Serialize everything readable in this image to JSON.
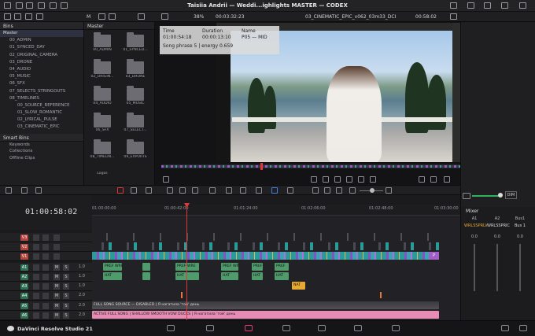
{
  "window": {
    "title": "Taisiia  Andrii — Weddi...ighlights MASTER — CODEX",
    "zoom": "38%",
    "source_timecode": "00:03:32:23",
    "clip_name": "03_CINEMATIC_EPIC_v062_03m33_DCI",
    "record_timecode": "00:58:02"
  },
  "toolbar": {
    "media_label": "M"
  },
  "bins": {
    "header": "Bins",
    "root": "Master",
    "items": [
      "00_ADMIN",
      "01_SYNCED_DAY",
      "02_ORIGINAL_CAMERA",
      "03_DRONE",
      "04_AUDIO",
      "05_MUSIC",
      "06_SFX",
      "07_SELECTS_STRINGOUTS",
      "08_TIMELINES"
    ],
    "subitems": [
      "00_SOURCE_REFERENCE",
      "01_SLOW_ROMANTIC",
      "02_LYRICAL_PULSE",
      "03_CINEMATIC_EPIC"
    ],
    "smart_bins_header": "Smart Bins",
    "smart_bins": [
      "Keywords",
      "Collections",
      "Offline Clips"
    ]
  },
  "media_pool": {
    "header": "Master",
    "folders": [
      "00_ADMIN",
      "01_SYNCED...",
      "02_ORIGIN...",
      "03_DRONE",
      "04_AUDIO",
      "05_MUSIC",
      "06_SFX",
      "07_SELECT...",
      "08_TIMELIN...",
      "09_EXPORTS",
      "Logos"
    ]
  },
  "info_box": {
    "col1_header": "Time",
    "col1_value": "01:00:54:18",
    "col2_header": "Duration",
    "col2_value": "00:00:13:10",
    "col3_header": "Name",
    "col3_value": "P05 — MID",
    "note": "Song phrase 5 | energy 0.659"
  },
  "timeline": {
    "timecode": "01:00:58:02",
    "ruler": [
      "01:00:00:00",
      "01:00:42:00",
      "01:01:24:00",
      "01:02:06:00",
      "01:02:48:00",
      "01:03:30:00"
    ],
    "tracks": [
      {
        "name": "V3",
        "color": "#b0463f",
        "kind": "video",
        "volume": ""
      },
      {
        "name": "V2",
        "color": "#b0463f",
        "kind": "video",
        "volume": ""
      },
      {
        "name": "V1",
        "color": "#b0463f",
        "kind": "video",
        "volume": ""
      },
      {
        "name": "A1",
        "color": "#2f6f54",
        "kind": "audio",
        "volume": "1.0"
      },
      {
        "name": "A2",
        "color": "#2f6f54",
        "kind": "audio",
        "volume": "1.0"
      },
      {
        "name": "A3",
        "color": "#2f6f54",
        "kind": "audio",
        "volume": "1.0"
      },
      {
        "name": "A4",
        "color": "#2f6f54",
        "kind": "audio",
        "volume": "2.0"
      },
      {
        "name": "A5",
        "color": "#2f6f54",
        "kind": "audio",
        "volume": "2.0"
      },
      {
        "name": "A6",
        "color": "#2f6f54",
        "kind": "audio",
        "volume": "2.0"
      }
    ],
    "btn_m": "M",
    "btn_s": "S",
    "clip_labels": {
      "a1": [
        "PREF WRE",
        "PREF WRE",
        "PREF WRE",
        "PREF",
        "PREF"
      ],
      "a2": [
        "HAT",
        "HAT",
        "HAT",
        "HAT",
        "HAT"
      ],
      "a3": "NAT",
      "a5": "FULL SONG SOURCE — DISABLED | Я нагатила 'той' день",
      "a6": "ACTIVE FULL SONG | SHALLOW SMOOTH VOW DUCKS | Я нагатила 'той' день"
    }
  },
  "mixer": {
    "header": "Mixer",
    "channels": [
      "A1",
      "A2",
      "Bus1"
    ],
    "labels": [
      "WRLSSPRLV",
      "WRLSSPRIC",
      "Bus 1"
    ],
    "values": [
      "0.0",
      "0.0",
      "0.0"
    ],
    "dim": "DIM"
  },
  "app": {
    "name": "DaVinci Resolve Studio 21"
  },
  "colors": {
    "accent": "#d8383a",
    "purple_clip": "#a25fc8",
    "teal_clip": "#2a9a9a",
    "audio_clip": "#3f7d58",
    "pink_clip": "#e78bb5"
  }
}
